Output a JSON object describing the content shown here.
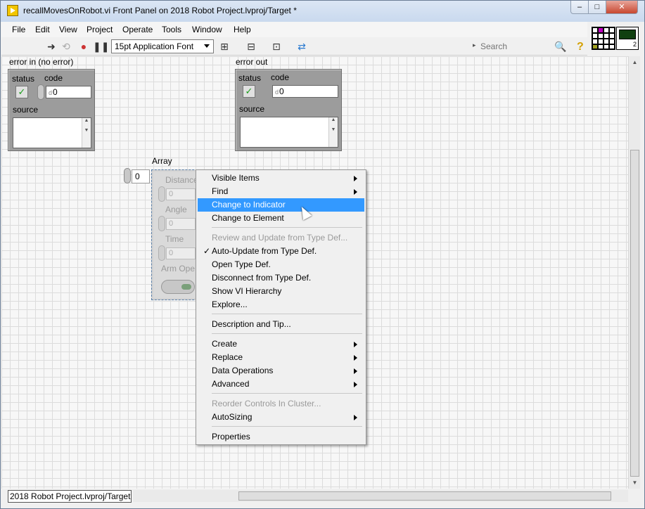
{
  "window": {
    "title": "recallMovesOnRobot.vi Front Panel on 2018 Robot Project.lvproj/Target *",
    "min_symbol": "–",
    "max_symbol": "□",
    "close_symbol": "✕"
  },
  "menubar": [
    "File",
    "Edit",
    "View",
    "Project",
    "Operate",
    "Tools",
    "Window",
    "Help"
  ],
  "toolbar": {
    "font": "15pt Application Font",
    "search_placeholder": "Search",
    "search_arrow": "▸",
    "help_symbol": "?",
    "vi_icon_number": "2"
  },
  "error_in": {
    "label": "error in (no error)",
    "status_label": "status",
    "code_label": "code",
    "code_value": "0",
    "code_radix": "d",
    "source_label": "source",
    "status_check": "✓"
  },
  "error_out": {
    "label": "error out",
    "status_label": "status",
    "code_label": "code",
    "code_value": "0",
    "code_radix": "d",
    "source_label": "source",
    "status_check": "✓"
  },
  "array": {
    "label": "Array",
    "index": "0",
    "fields": [
      {
        "label": "Distance",
        "value": "0"
      },
      {
        "label": "Angle",
        "value": "0"
      },
      {
        "label": "Time",
        "value": "0"
      }
    ],
    "bool_label": "Arm Ope"
  },
  "context_menu": {
    "items": [
      {
        "label": "Visible Items",
        "submenu": true
      },
      {
        "label": "Find",
        "submenu": true
      },
      {
        "label": "Change to Indicator",
        "highlighted": true
      },
      {
        "label": "Change to Element"
      },
      {
        "label": "Review and Update from Type Def...",
        "disabled": true
      },
      {
        "label": "Auto-Update from Type Def.",
        "checked": true
      },
      {
        "label": "Open Type Def."
      },
      {
        "label": "Disconnect from Type Def."
      },
      {
        "label": "Show VI Hierarchy"
      },
      {
        "label": "Explore..."
      },
      {
        "label": "Description and Tip..."
      },
      {
        "label": "Create",
        "submenu": true
      },
      {
        "label": "Replace",
        "submenu": true
      },
      {
        "label": "Data Operations",
        "submenu": true
      },
      {
        "label": "Advanced",
        "submenu": true
      },
      {
        "label": "Reorder Controls In Cluster...",
        "disabled": true
      },
      {
        "label": "AutoSizing",
        "submenu": true
      },
      {
        "label": "Properties"
      }
    ],
    "check_symbol": "✓"
  },
  "statusbar": {
    "target": "2018 Robot Project.lvproj/Target"
  }
}
